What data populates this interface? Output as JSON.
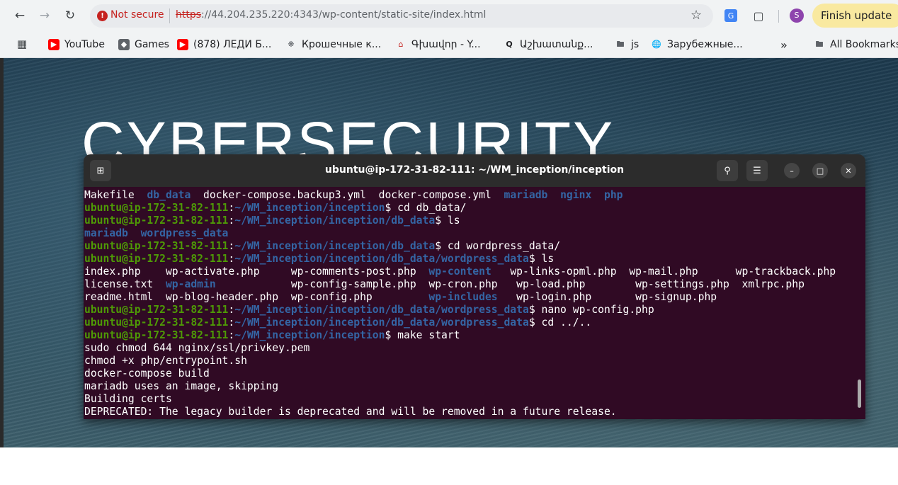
{
  "browser": {
    "security_label": "Not secure",
    "url_protocol": "https",
    "url_rest": "://44.204.235.220:4343/wp-content/static-site/index.html",
    "finish_update": "Finish update",
    "avatar_letter": "S",
    "bookmarks": [
      {
        "label": "YouTube",
        "icon": "youtube-icon"
      },
      {
        "label": "Games",
        "icon": "games-icon"
      },
      {
        "label": "(878) ЛЕДИ Б...",
        "icon": "youtube-icon"
      },
      {
        "label": "Крошечные к...",
        "icon": "site-icon"
      },
      {
        "label": "Գխավոր - Y...",
        "icon": "site-icon"
      },
      {
        "label": "Աշխատանք...",
        "icon": "search-icon"
      },
      {
        "label": "js",
        "icon": "folder-icon"
      },
      {
        "label": "Зарубежные...",
        "icon": "globe-icon"
      }
    ],
    "more_label": "»",
    "all_bookmarks": "All Bookmarks"
  },
  "page": {
    "hero_title": "CYBERSECURITY"
  },
  "terminal": {
    "title": "ubuntu@ip-172-31-82-111: ~/WM_inception/inception",
    "lines": [
      [
        [
          "",
          "Makefile  "
        ],
        [
          "b",
          "db_data"
        ],
        [
          "",
          "  docker-compose.backup3.yml  docker-compose.yml  "
        ],
        [
          "b",
          "mariadb"
        ],
        [
          "",
          "  "
        ],
        [
          "b",
          "nginx"
        ],
        [
          "",
          "  "
        ],
        [
          "b",
          "php"
        ]
      ],
      [
        [
          "g",
          "ubuntu@ip-172-31-82-111"
        ],
        [
          "",
          ":"
        ],
        [
          "b",
          "~/WM_inception/inception"
        ],
        [
          "",
          "$ cd db_data/"
        ]
      ],
      [
        [
          "g",
          "ubuntu@ip-172-31-82-111"
        ],
        [
          "",
          ":"
        ],
        [
          "b",
          "~/WM_inception/inception/db_data"
        ],
        [
          "",
          "$ ls"
        ]
      ],
      [
        [
          "b",
          "mariadb"
        ],
        [
          "",
          "  "
        ],
        [
          "b",
          "wordpress_data"
        ]
      ],
      [
        [
          "g",
          "ubuntu@ip-172-31-82-111"
        ],
        [
          "",
          ":"
        ],
        [
          "b",
          "~/WM_inception/inception/db_data"
        ],
        [
          "",
          "$ cd wordpress_data/"
        ]
      ],
      [
        [
          "g",
          "ubuntu@ip-172-31-82-111"
        ],
        [
          "",
          ":"
        ],
        [
          "b",
          "~/WM_inception/inception/db_data/wordpress_data"
        ],
        [
          "",
          "$ ls"
        ]
      ],
      [
        [
          "",
          "index.php    wp-activate.php     wp-comments-post.php  "
        ],
        [
          "b",
          "wp-content"
        ],
        [
          "",
          "   wp-links-opml.php  wp-mail.php      wp-trackback.php"
        ]
      ],
      [
        [
          "",
          "license.txt  "
        ],
        [
          "b",
          "wp-admin"
        ],
        [
          "",
          "            wp-config-sample.php  wp-cron.php   wp-load.php        wp-settings.php  xmlrpc.php"
        ]
      ],
      [
        [
          "",
          "readme.html  wp-blog-header.php  wp-config.php         "
        ],
        [
          "b",
          "wp-includes"
        ],
        [
          "",
          "   wp-login.php       wp-signup.php"
        ]
      ],
      [
        [
          "g",
          "ubuntu@ip-172-31-82-111"
        ],
        [
          "",
          ":"
        ],
        [
          "b",
          "~/WM_inception/inception/db_data/wordpress_data"
        ],
        [
          "",
          "$ nano wp-config.php"
        ]
      ],
      [
        [
          "g",
          "ubuntu@ip-172-31-82-111"
        ],
        [
          "",
          ":"
        ],
        [
          "b",
          "~/WM_inception/inception/db_data/wordpress_data"
        ],
        [
          "",
          "$ cd ../.."
        ]
      ],
      [
        [
          "g",
          "ubuntu@ip-172-31-82-111"
        ],
        [
          "",
          ":"
        ],
        [
          "b",
          "~/WM_inception/inception"
        ],
        [
          "",
          "$ make start"
        ]
      ],
      [
        [
          "",
          "sudo chmod 644 nginx/ssl/privkey.pem"
        ]
      ],
      [
        [
          "",
          "chmod +x php/entrypoint.sh"
        ]
      ],
      [
        [
          "",
          "docker-compose build"
        ]
      ],
      [
        [
          "",
          "mariadb uses an image, skipping"
        ]
      ],
      [
        [
          "",
          "Building certs"
        ]
      ],
      [
        [
          "",
          "DEPRECATED: The legacy builder is deprecated and will be removed in a future release."
        ]
      ]
    ]
  }
}
